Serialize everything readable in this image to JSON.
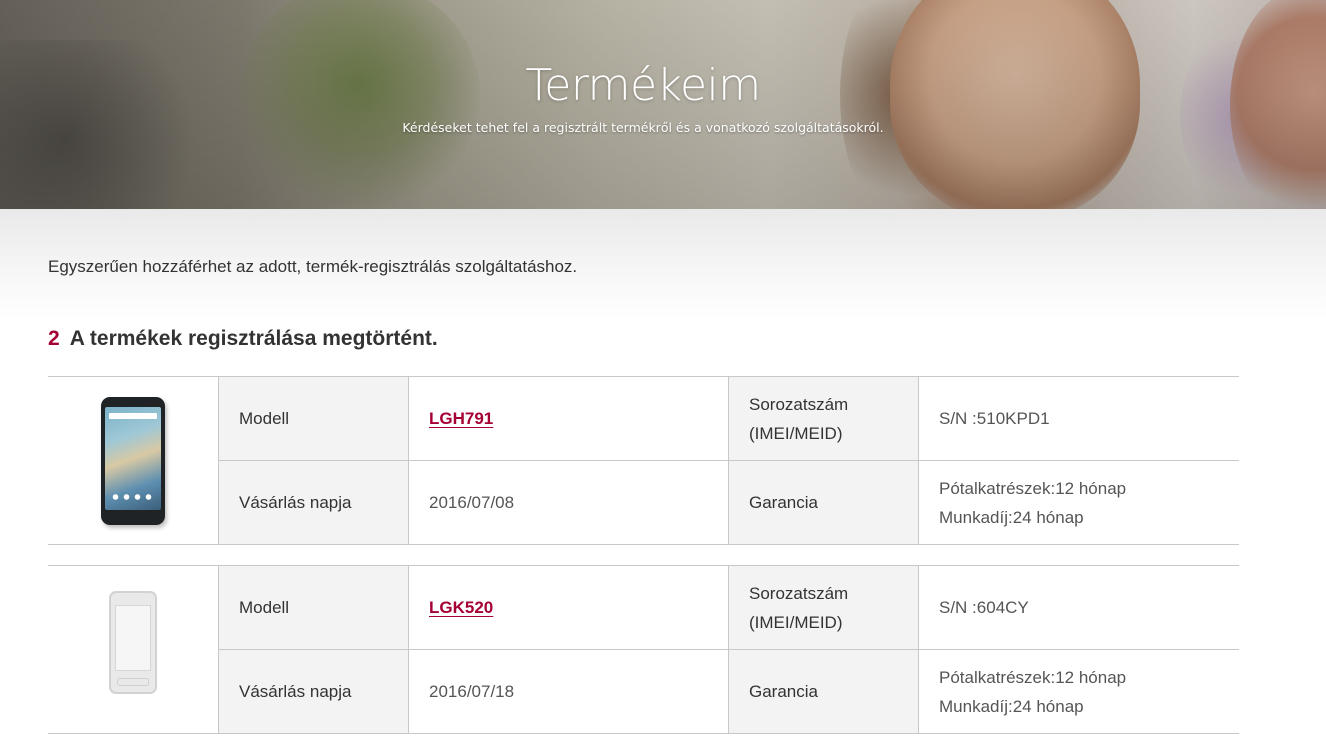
{
  "hero": {
    "title": "Termékeim",
    "subtitle": "Kérdéseket tehet fel a regisztrált termékről és a vonatkozó szolgáltatásokról."
  },
  "intro": {
    "text": "Egyszerűen hozzáférhet az adott, termék-regisztrálás szolgáltatáshoz."
  },
  "registered": {
    "count": "2",
    "label": "A termékek regisztrálása megtörtént."
  },
  "products": [
    {
      "image_icon": "phone-dark-icon",
      "model_label": "Modell",
      "model": "LGH791",
      "serial_label_line1": "Sorozatszám",
      "serial_label_line2": "(IMEI/MEID)",
      "serial": "S/N :510KPD1",
      "date_label": "Vásárlás napja",
      "date": "2016/07/08",
      "warranty_label": "Garancia",
      "warranty_parts": "Pótalkatrészek:12 hónap",
      "warranty_labor": "Munkadíj:24 hónap"
    },
    {
      "image_icon": "phone-light-icon",
      "model_label": "Modell",
      "model": "LGK520",
      "serial_label_line1": "Sorozatszám",
      "serial_label_line2": "(IMEI/MEID)",
      "serial": "S/N :604CY",
      "date_label": "Vásárlás napja",
      "date": "2016/07/18",
      "warranty_label": "Garancia",
      "warranty_parts": "Pótalkatrészek:12 hónap",
      "warranty_labor": "Munkadíj:24 hónap"
    }
  ],
  "colors": {
    "accent": "#a50034",
    "label_bg": "#f3f3f3",
    "border": "#c8c8c8"
  }
}
